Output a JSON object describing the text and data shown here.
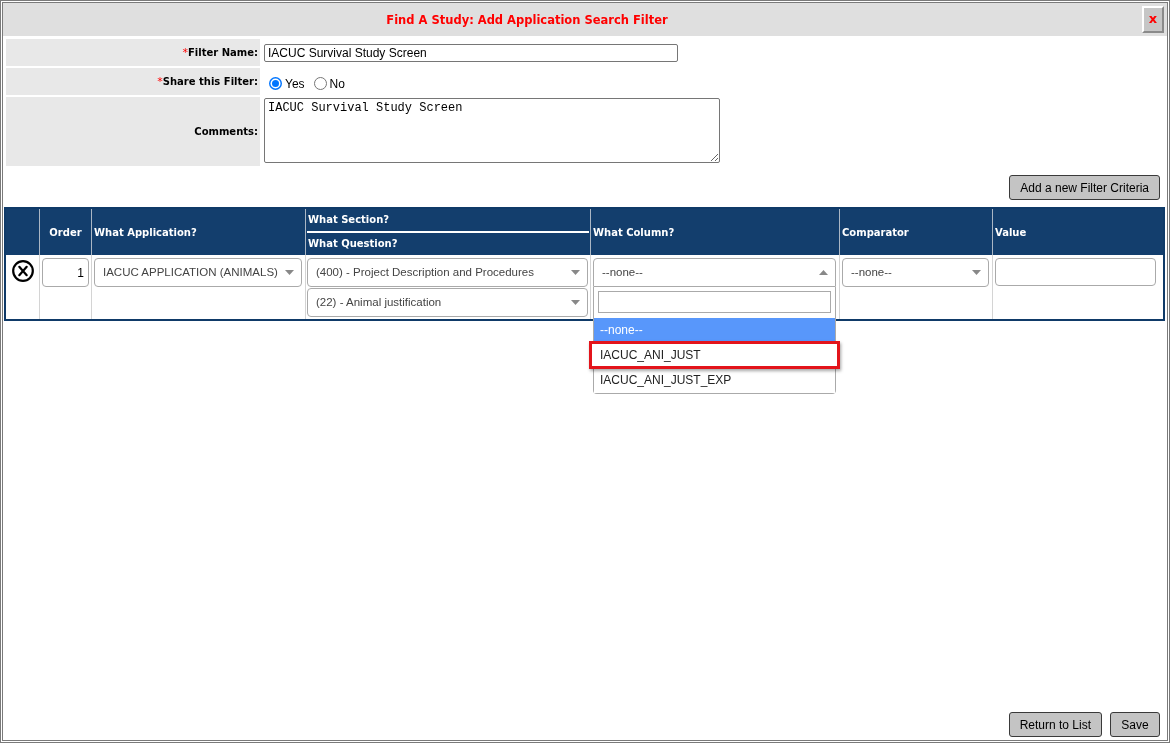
{
  "dialog": {
    "title": "Find A Study: Add Application Search Filter",
    "close_button": "x"
  },
  "form": {
    "fields": [
      {
        "kind": "text",
        "required_mark": "*",
        "label": "Filter Name:",
        "value": "IACUC Survival Study Screen"
      },
      {
        "kind": "radio",
        "required_mark": "*",
        "label": "Share this Filter:",
        "options": [
          {
            "label": "Yes",
            "selected": true
          },
          {
            "label": "No",
            "selected": false
          }
        ]
      },
      {
        "kind": "textarea",
        "label": "Comments:",
        "value": "IACUC Survival Study Screen"
      }
    ]
  },
  "add_criteria_button": "Add a new Filter Criteria",
  "criteria_table": {
    "columns": [
      {
        "label": "Order"
      },
      {
        "label": "What Application?"
      },
      {
        "label": "What Section?",
        "sublabel": "What Question?"
      },
      {
        "label": "What Column?"
      },
      {
        "label": "Comparator"
      },
      {
        "label": "Value"
      }
    ],
    "rows": [
      {
        "order": "1",
        "application": {
          "value": "IACUC APPLICATION (ANIMALS)",
          "expanded": false
        },
        "section": {
          "value": "(400) - Project Description and Procedures",
          "expanded": false
        },
        "question": {
          "value": "(22) - Animal justification",
          "expanded": false
        },
        "column": {
          "value": "--none--",
          "expanded": true,
          "options": [
            {
              "label": "--none--",
              "selected": true,
              "highlighted": false
            },
            {
              "label": "IACUC_ANI_JUST",
              "selected": false,
              "highlighted": true
            },
            {
              "label": "IACUC_ANI_JUST_EXP",
              "selected": false,
              "highlighted": false
            }
          ]
        },
        "comparator": {
          "value": "--none--",
          "expanded": false
        }
      }
    ]
  },
  "footer_buttons": [
    "Return to List",
    "Save"
  ]
}
